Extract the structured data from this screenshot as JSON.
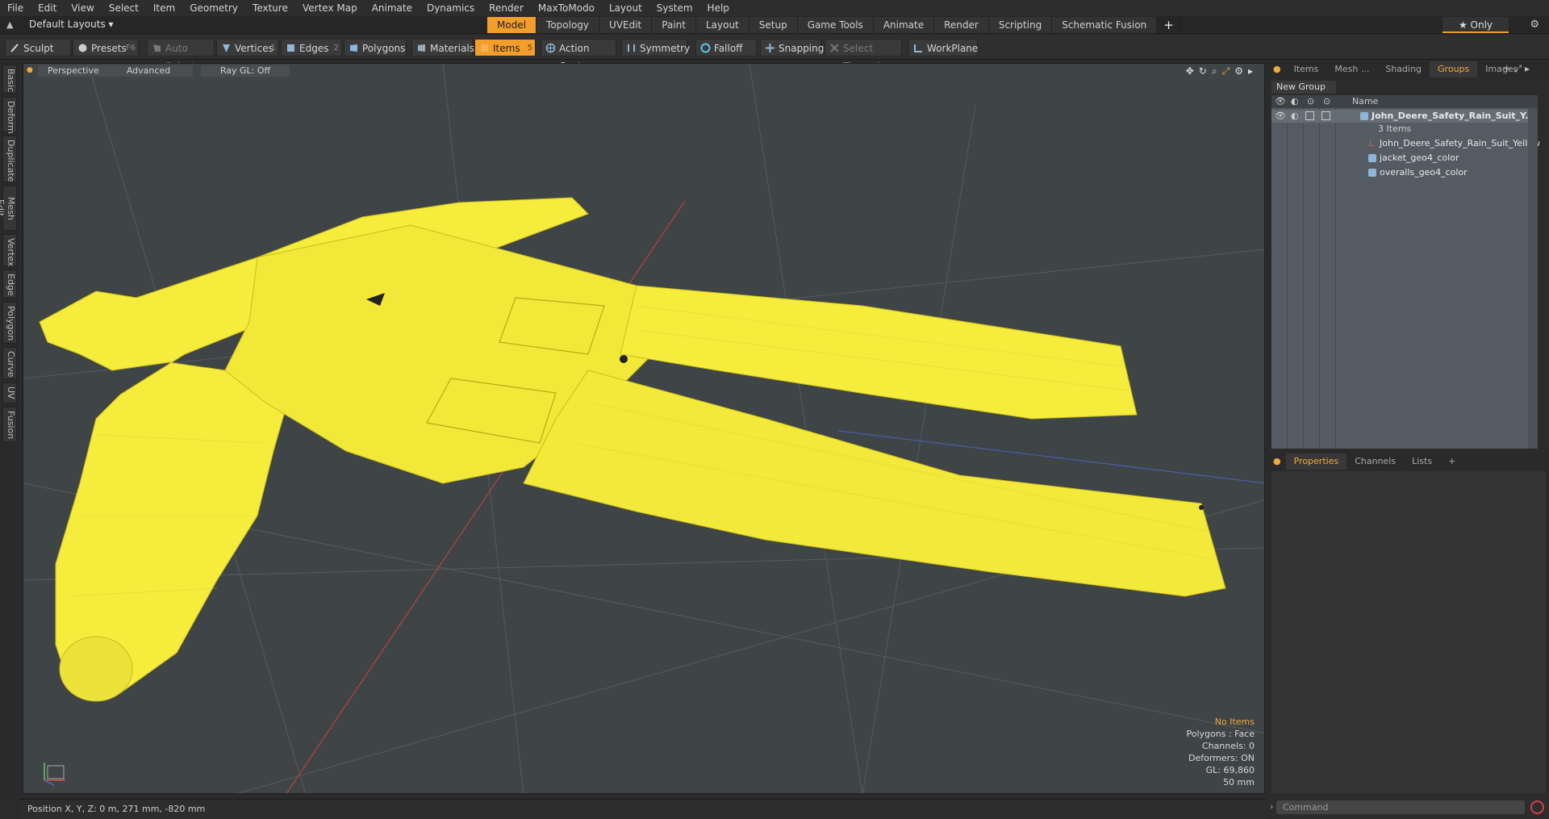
{
  "menu": [
    "File",
    "Edit",
    "View",
    "Select",
    "Item",
    "Geometry",
    "Texture",
    "Vertex Map",
    "Animate",
    "Dynamics",
    "Render",
    "MaxToModo",
    "Layout",
    "System",
    "Help"
  ],
  "layout": {
    "selector": "Default Layouts ▾",
    "tabs": [
      "Model",
      "Topology",
      "UVEdit",
      "Paint",
      "Layout",
      "Setup",
      "Game Tools",
      "Animate",
      "Render",
      "Scripting",
      "Schematic Fusion"
    ],
    "active_tab": "Model",
    "only_label": "★  Only"
  },
  "toolbar": {
    "sculpt": "Sculpt",
    "presets": "Presets",
    "presets_key": "F6",
    "auto_select": "Auto Select",
    "vertices": "Vertices",
    "vertices_key": "1",
    "edges": "Edges",
    "edges_key": "2",
    "polygons": "Polygons",
    "materials": "Materials",
    "items": "Items",
    "items_key": "5",
    "action_center": "Action Center",
    "symmetry": "Symmetry",
    "falloff": "Falloff",
    "snapping": "Snapping",
    "select_through": "Select Through",
    "workplane": "WorkPlane"
  },
  "left_tabs": [
    "Basic",
    "Deform",
    "Duplicate",
    "Mesh Edit",
    "Vertex",
    "Edge",
    "Polygon",
    "Curve",
    "UV",
    "Fusion"
  ],
  "viewport": {
    "view": "Perspective",
    "shading": "Advanced",
    "raygl": "Ray GL: Off",
    "stats": {
      "items": "No Items",
      "polygons": "Polygons : Face",
      "channels": "Channels: 0",
      "deformers": "Deformers: ON",
      "gl": "GL: 69,860",
      "scale": "50 mm"
    }
  },
  "status": {
    "position": "Position X, Y, Z:   0 m, 271 mm, -820 mm"
  },
  "right_panel": {
    "tabs": [
      "Items",
      "Mesh ...",
      "Shading",
      "Groups",
      "Images"
    ],
    "active_tab": "Groups",
    "new_group": "New Group",
    "name_header": "Name",
    "group_name": "John_Deere_Safety_Rain_Suit_Y...",
    "group_count": "3 Items",
    "children": [
      "John_Deere_Safety_Rain_Suit_Yellow",
      "jacket_geo4_color",
      "overalls_geo4_color"
    ],
    "props_tabs": [
      "Properties",
      "Channels",
      "Lists"
    ],
    "props_active": "Properties",
    "command_placeholder": "Command"
  },
  "colors": {
    "accent": "#f29d2c",
    "suit": "#f5ec3c",
    "viewport_bg": "#3f4447"
  }
}
